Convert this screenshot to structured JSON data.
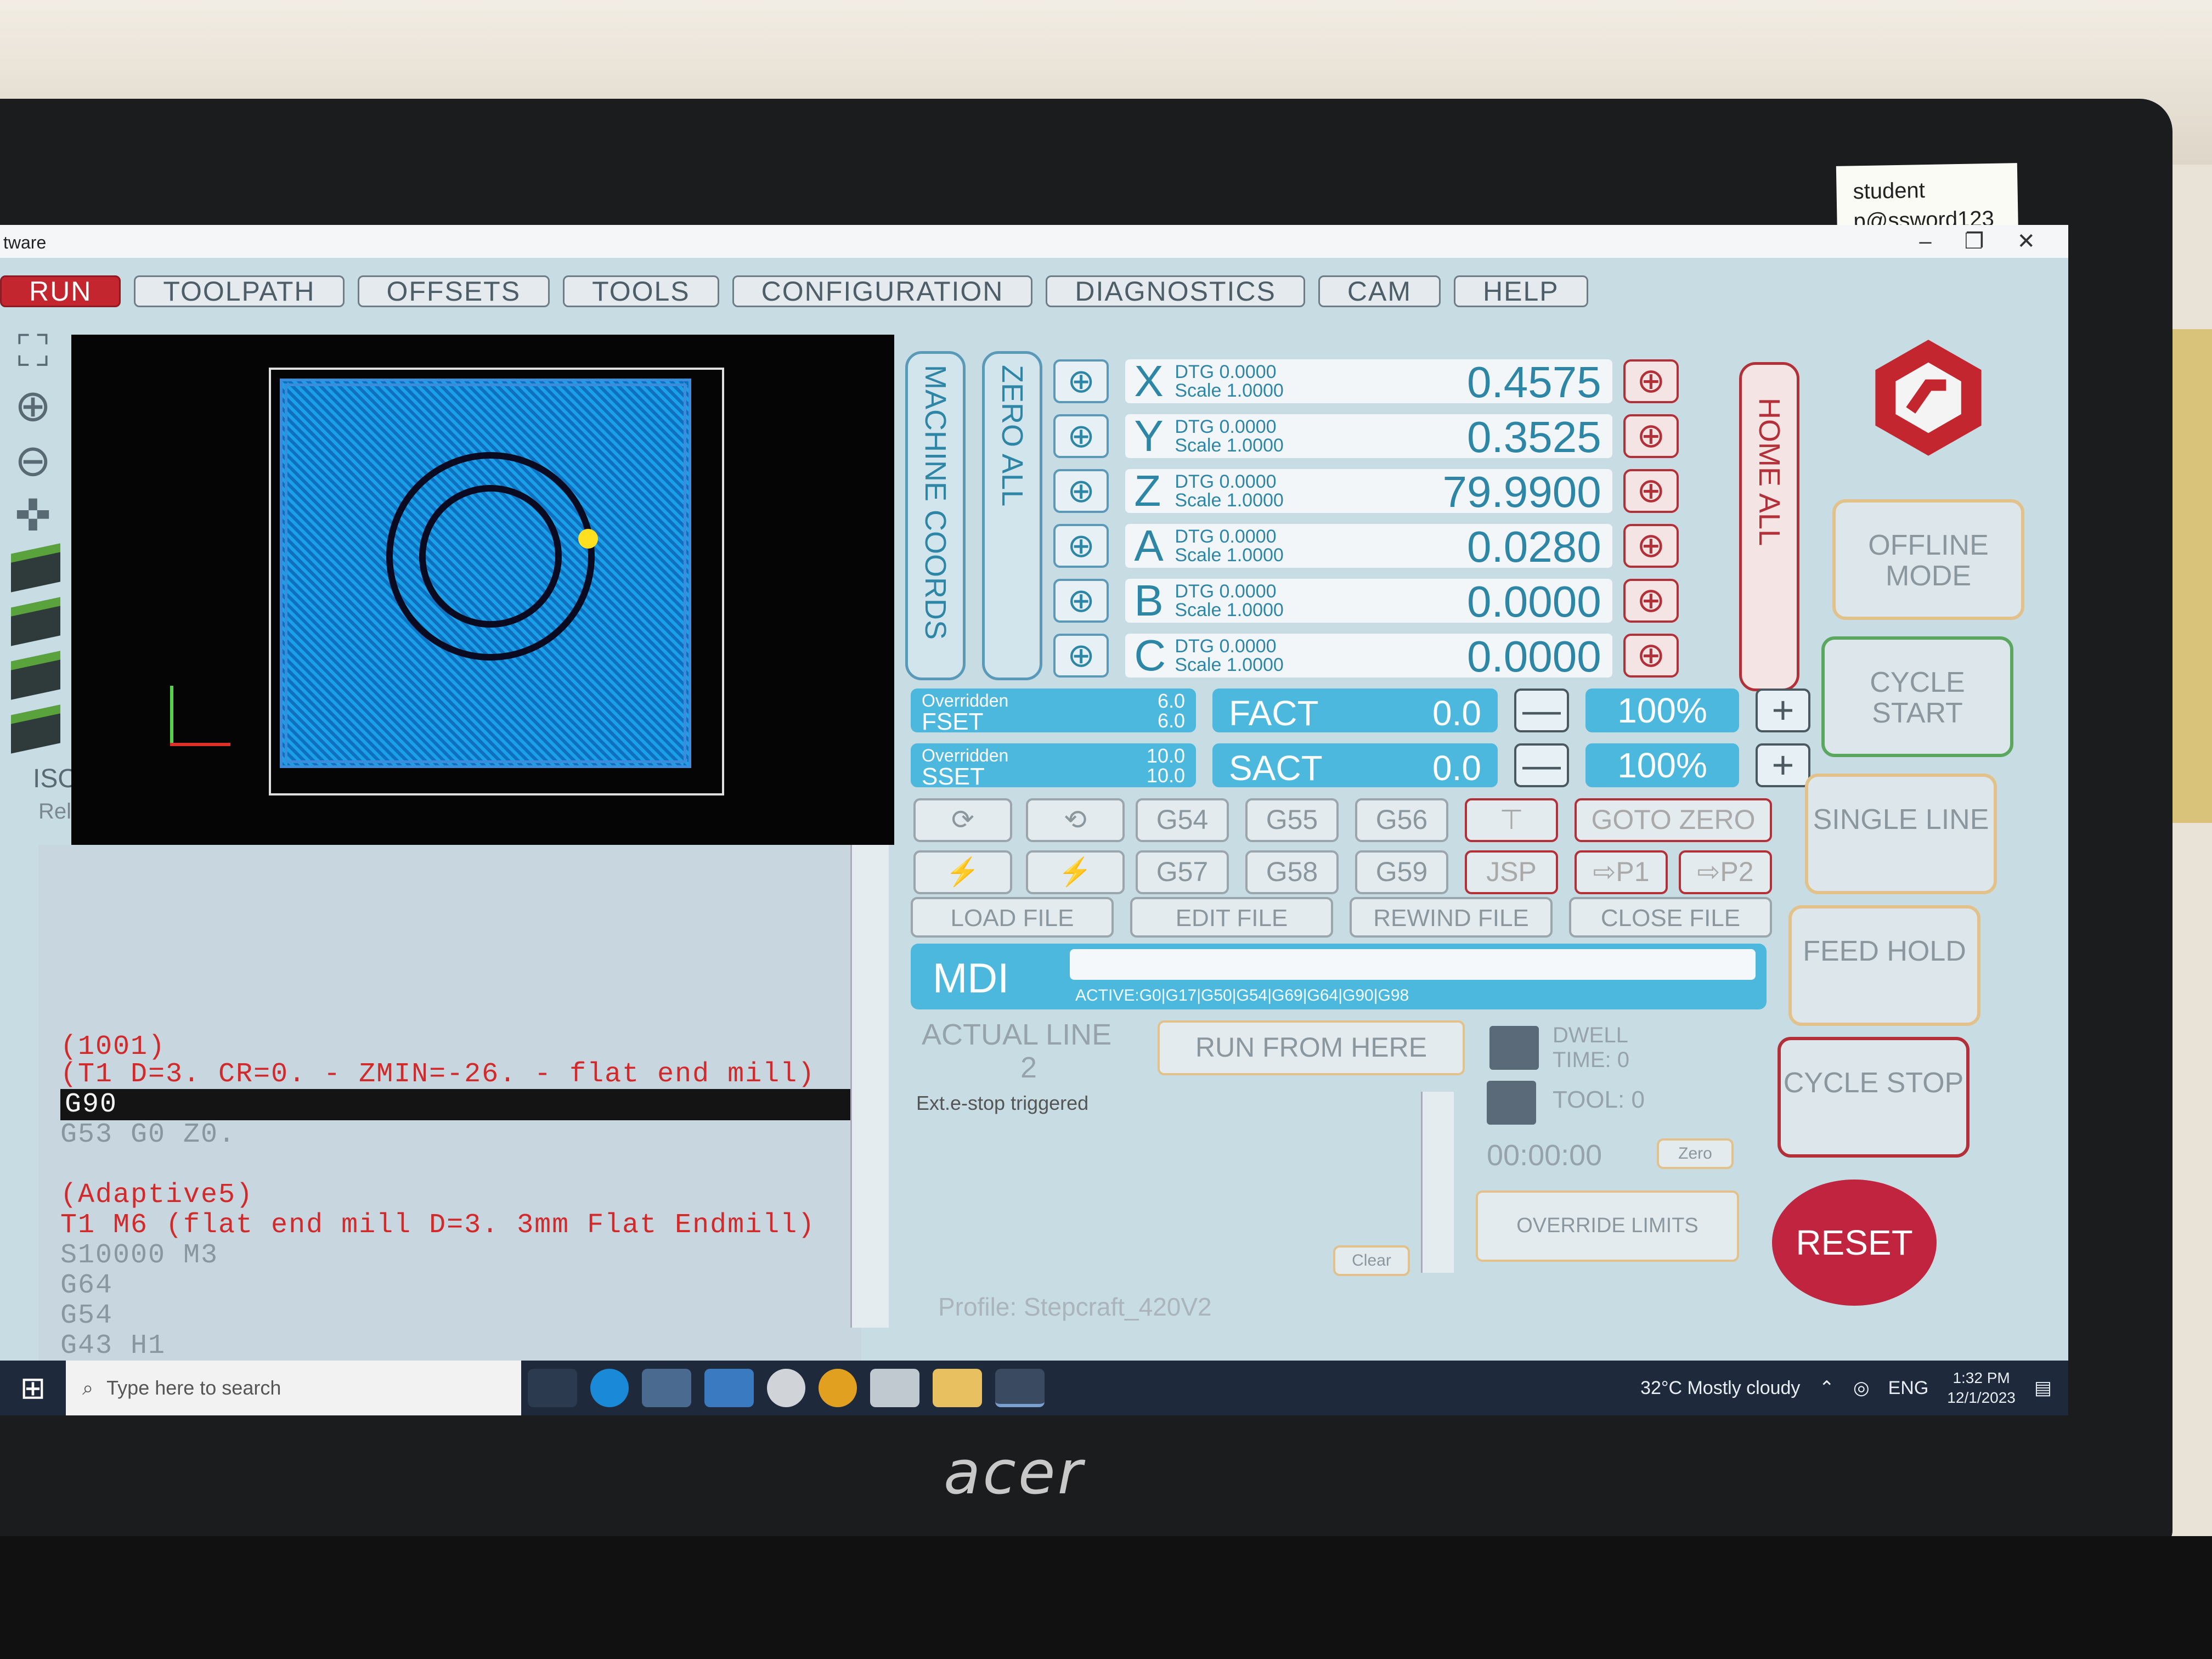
{
  "sticky_note": {
    "line1": "student",
    "line2": "p@ssword123"
  },
  "laptop_brand": "acer",
  "window": {
    "title": "tware",
    "minimize": "–",
    "maximize": "❐",
    "close": "✕"
  },
  "tabs": [
    "RUN",
    "TOOLPATH",
    "OFFSETS",
    "TOOLS",
    "CONFIGURATION",
    "DIAGNOSTICS",
    "CAM",
    "HELP"
  ],
  "left_toolbar": {
    "iso_label": "ISO",
    "reload_label": "Reload"
  },
  "machine_coords_label": "MACHINE COORDS",
  "zero_all_label": "ZERO ALL",
  "home_all_label": "HOME ALL",
  "dro": [
    {
      "axis": "X",
      "dtg": "DTG  0.0000",
      "scale": "Scale 1.0000",
      "value": "0.4575"
    },
    {
      "axis": "Y",
      "dtg": "DTG  0.0000",
      "scale": "Scale 1.0000",
      "value": "0.3525"
    },
    {
      "axis": "Z",
      "dtg": "DTG  0.0000",
      "scale": "Scale 1.0000",
      "value": "79.9900"
    },
    {
      "axis": "A",
      "dtg": "DTG  0.0000",
      "scale": "Scale 1.0000",
      "value": "0.0280"
    },
    {
      "axis": "B",
      "dtg": "DTG  0.0000",
      "scale": "Scale 1.0000",
      "value": "0.0000"
    },
    {
      "axis": "C",
      "dtg": "DTG  0.0000",
      "scale": "Scale 1.0000",
      "value": "0.0000"
    }
  ],
  "feed": {
    "overridden": "Overridden",
    "label": "FSET",
    "over_val": "6.0",
    "set_val": "6.0",
    "act_label": "FACT",
    "act_val": "0.0",
    "pct": "100%"
  },
  "spindle": {
    "overridden": "Overridden",
    "label": "SSET",
    "over_val": "10.0",
    "set_val": "10.0",
    "act_label": "SACT",
    "act_val": "0.0",
    "pct": "100%"
  },
  "plus": "+",
  "minus": "—",
  "gbuttons_row1": [
    "G54",
    "G55",
    "G56",
    "GOTO ZERO"
  ],
  "gbuttons_row2": [
    "G57",
    "G58",
    "G59",
    "JSP",
    "⇨P1",
    "⇨P2"
  ],
  "file_buttons": [
    "LOAD FILE",
    "EDIT FILE",
    "REWIND FILE",
    "CLOSE FILE"
  ],
  "mdi": {
    "label": "MDI",
    "active": "ACTIVE:G0|G17|G50|G54|G69|G64|G90|G98"
  },
  "actual_line": {
    "label": "ACTUAL LINE",
    "value": "2"
  },
  "status_msg": "Ext.e-stop triggered",
  "run_from_here": "RUN FROM HERE",
  "dwell": "DWELL TIME:  0",
  "tool": "TOOL:  0",
  "timer": "00:00:00",
  "zero_btn": "Zero",
  "clear_btn": "Clear",
  "override_limits": "OVERRIDE LIMITS",
  "profile": "Profile: Stepcraft_420V2",
  "side_buttons": [
    "OFFLINE MODE",
    "CYCLE START",
    "SINGLE LINE",
    "FEED HOLD",
    "CYCLE STOP"
  ],
  "reset": "RESET",
  "gcode_lines": [
    {
      "text": "(1001)",
      "kind": "comment"
    },
    {
      "text": "(T1  D=3. CR=0. - ZMIN=-26. - flat end mill)",
      "kind": "comment"
    },
    {
      "text": "G90",
      "kind": "cur"
    },
    {
      "text": "G53 G0 Z0.",
      "kind": "normal"
    },
    {
      "text": "",
      "kind": "normal"
    },
    {
      "text": "(Adaptive5)",
      "kind": "comment"
    },
    {
      "text": "T1 M6 (flat end mill D=3. 3mm Flat Endmill)",
      "kind": "comment"
    },
    {
      "text": "S10000 M3",
      "kind": "normal"
    },
    {
      "text": "G64",
      "kind": "normal"
    },
    {
      "text": "G54",
      "kind": "normal"
    },
    {
      "text": "G43 H1",
      "kind": "normal"
    }
  ],
  "taskbar": {
    "search_placeholder": "Type here to search",
    "weather": "32°C  Mostly cloudy",
    "lang": "ENG",
    "time": "1:32 PM",
    "date": "12/1/2023"
  }
}
